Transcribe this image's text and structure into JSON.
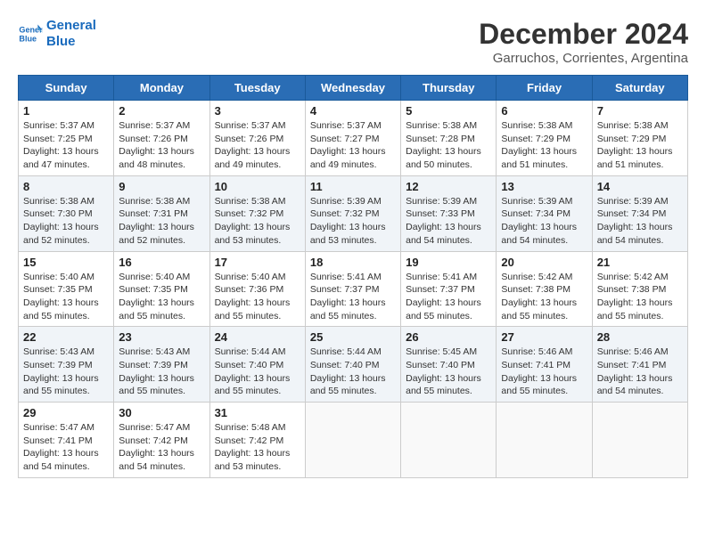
{
  "header": {
    "logo_line1": "General",
    "logo_line2": "Blue",
    "month_title": "December 2024",
    "subtitle": "Garruchos, Corrientes, Argentina"
  },
  "weekdays": [
    "Sunday",
    "Monday",
    "Tuesday",
    "Wednesday",
    "Thursday",
    "Friday",
    "Saturday"
  ],
  "weeks": [
    [
      {
        "day": "1",
        "info": "Sunrise: 5:37 AM\nSunset: 7:25 PM\nDaylight: 13 hours\nand 47 minutes."
      },
      {
        "day": "2",
        "info": "Sunrise: 5:37 AM\nSunset: 7:26 PM\nDaylight: 13 hours\nand 48 minutes."
      },
      {
        "day": "3",
        "info": "Sunrise: 5:37 AM\nSunset: 7:26 PM\nDaylight: 13 hours\nand 49 minutes."
      },
      {
        "day": "4",
        "info": "Sunrise: 5:37 AM\nSunset: 7:27 PM\nDaylight: 13 hours\nand 49 minutes."
      },
      {
        "day": "5",
        "info": "Sunrise: 5:38 AM\nSunset: 7:28 PM\nDaylight: 13 hours\nand 50 minutes."
      },
      {
        "day": "6",
        "info": "Sunrise: 5:38 AM\nSunset: 7:29 PM\nDaylight: 13 hours\nand 51 minutes."
      },
      {
        "day": "7",
        "info": "Sunrise: 5:38 AM\nSunset: 7:29 PM\nDaylight: 13 hours\nand 51 minutes."
      }
    ],
    [
      {
        "day": "8",
        "info": "Sunrise: 5:38 AM\nSunset: 7:30 PM\nDaylight: 13 hours\nand 52 minutes."
      },
      {
        "day": "9",
        "info": "Sunrise: 5:38 AM\nSunset: 7:31 PM\nDaylight: 13 hours\nand 52 minutes."
      },
      {
        "day": "10",
        "info": "Sunrise: 5:38 AM\nSunset: 7:32 PM\nDaylight: 13 hours\nand 53 minutes."
      },
      {
        "day": "11",
        "info": "Sunrise: 5:39 AM\nSunset: 7:32 PM\nDaylight: 13 hours\nand 53 minutes."
      },
      {
        "day": "12",
        "info": "Sunrise: 5:39 AM\nSunset: 7:33 PM\nDaylight: 13 hours\nand 54 minutes."
      },
      {
        "day": "13",
        "info": "Sunrise: 5:39 AM\nSunset: 7:34 PM\nDaylight: 13 hours\nand 54 minutes."
      },
      {
        "day": "14",
        "info": "Sunrise: 5:39 AM\nSunset: 7:34 PM\nDaylight: 13 hours\nand 54 minutes."
      }
    ],
    [
      {
        "day": "15",
        "info": "Sunrise: 5:40 AM\nSunset: 7:35 PM\nDaylight: 13 hours\nand 55 minutes."
      },
      {
        "day": "16",
        "info": "Sunrise: 5:40 AM\nSunset: 7:35 PM\nDaylight: 13 hours\nand 55 minutes."
      },
      {
        "day": "17",
        "info": "Sunrise: 5:40 AM\nSunset: 7:36 PM\nDaylight: 13 hours\nand 55 minutes."
      },
      {
        "day": "18",
        "info": "Sunrise: 5:41 AM\nSunset: 7:37 PM\nDaylight: 13 hours\nand 55 minutes."
      },
      {
        "day": "19",
        "info": "Sunrise: 5:41 AM\nSunset: 7:37 PM\nDaylight: 13 hours\nand 55 minutes."
      },
      {
        "day": "20",
        "info": "Sunrise: 5:42 AM\nSunset: 7:38 PM\nDaylight: 13 hours\nand 55 minutes."
      },
      {
        "day": "21",
        "info": "Sunrise: 5:42 AM\nSunset: 7:38 PM\nDaylight: 13 hours\nand 55 minutes."
      }
    ],
    [
      {
        "day": "22",
        "info": "Sunrise: 5:43 AM\nSunset: 7:39 PM\nDaylight: 13 hours\nand 55 minutes."
      },
      {
        "day": "23",
        "info": "Sunrise: 5:43 AM\nSunset: 7:39 PM\nDaylight: 13 hours\nand 55 minutes."
      },
      {
        "day": "24",
        "info": "Sunrise: 5:44 AM\nSunset: 7:40 PM\nDaylight: 13 hours\nand 55 minutes."
      },
      {
        "day": "25",
        "info": "Sunrise: 5:44 AM\nSunset: 7:40 PM\nDaylight: 13 hours\nand 55 minutes."
      },
      {
        "day": "26",
        "info": "Sunrise: 5:45 AM\nSunset: 7:40 PM\nDaylight: 13 hours\nand 55 minutes."
      },
      {
        "day": "27",
        "info": "Sunrise: 5:46 AM\nSunset: 7:41 PM\nDaylight: 13 hours\nand 55 minutes."
      },
      {
        "day": "28",
        "info": "Sunrise: 5:46 AM\nSunset: 7:41 PM\nDaylight: 13 hours\nand 54 minutes."
      }
    ],
    [
      {
        "day": "29",
        "info": "Sunrise: 5:47 AM\nSunset: 7:41 PM\nDaylight: 13 hours\nand 54 minutes."
      },
      {
        "day": "30",
        "info": "Sunrise: 5:47 AM\nSunset: 7:42 PM\nDaylight: 13 hours\nand 54 minutes."
      },
      {
        "day": "31",
        "info": "Sunrise: 5:48 AM\nSunset: 7:42 PM\nDaylight: 13 hours\nand 53 minutes."
      },
      {
        "day": "",
        "info": ""
      },
      {
        "day": "",
        "info": ""
      },
      {
        "day": "",
        "info": ""
      },
      {
        "day": "",
        "info": ""
      }
    ]
  ]
}
